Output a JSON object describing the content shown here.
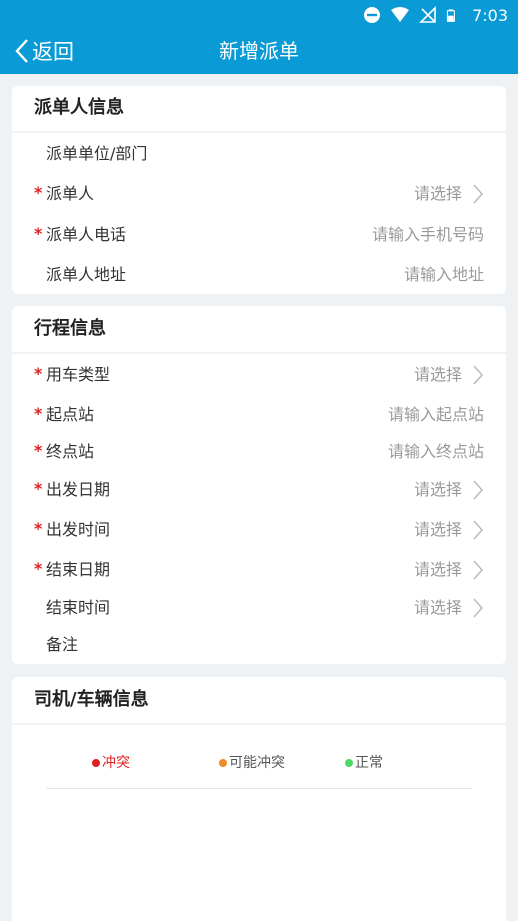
{
  "status_bar": {
    "time": "7:03"
  },
  "nav": {
    "back_label": "返回",
    "title": "新增派单"
  },
  "dispatcher_section": {
    "title": "派单人信息",
    "rows": [
      {
        "label": "派单单位/部门",
        "required": "",
        "value": ""
      },
      {
        "label": "派单人",
        "required": "*",
        "value": "请选择"
      },
      {
        "label": "派单人电话",
        "required": "*",
        "placeholder": "请输入手机号码"
      },
      {
        "label": "派单人地址",
        "required": "",
        "placeholder": "请输入地址"
      }
    ]
  },
  "trip_section": {
    "title": "行程信息",
    "rows": [
      {
        "label": "用车类型",
        "required": "*",
        "value": "请选择"
      },
      {
        "label": "起点站",
        "required": "*",
        "placeholder": "请输入起点站"
      },
      {
        "label": "终点站",
        "required": "*",
        "placeholder": "请输入终点站"
      },
      {
        "label": "出发日期",
        "required": "*",
        "value": "请选择"
      },
      {
        "label": "出发时间",
        "required": "*",
        "value": "请选择"
      },
      {
        "label": "结束日期",
        "required": "*",
        "value": "请选择"
      },
      {
        "label": "结束时间",
        "required": "",
        "value": "请选择"
      },
      {
        "label": "备注",
        "required": "",
        "value": ""
      }
    ]
  },
  "driver_section": {
    "title": "司机/车辆信息",
    "legend": [
      {
        "label": "冲突",
        "color": "#e02020"
      },
      {
        "label": "可能冲突",
        "color": "#f08a24"
      },
      {
        "label": "正常",
        "color": "#4cd964"
      }
    ]
  },
  "colors": {
    "header": "#0a9bd6",
    "required": "#e02020",
    "placeholder": "#9a9a9a"
  }
}
